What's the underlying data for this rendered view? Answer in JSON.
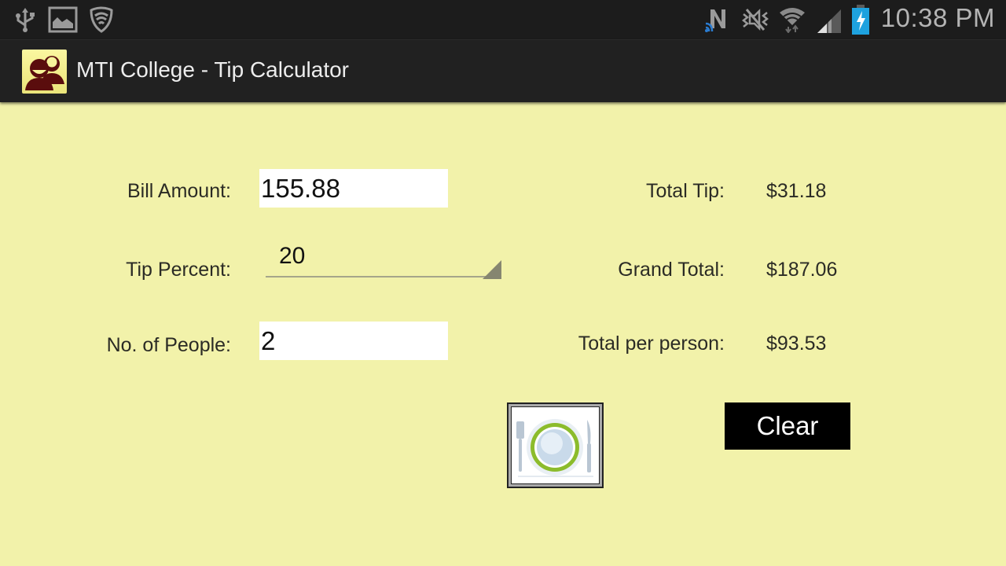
{
  "status_bar": {
    "left_icons": [
      "usb-icon",
      "image-icon",
      "shield-wifi-icon"
    ],
    "right_icons": [
      "nfc-icon",
      "mute-icon",
      "wifi-icon",
      "signal-icon",
      "battery-charging-icon"
    ],
    "time": "10:38 PM"
  },
  "action_bar": {
    "app_icon": "people-icon",
    "title": "MTI College - Tip Calculator"
  },
  "form": {
    "bill_amount": {
      "label": "Bill Amount:",
      "value": "155.88"
    },
    "tip_percent": {
      "label": "Tip Percent:",
      "selected": "20"
    },
    "people": {
      "label": "No. of People:",
      "value": "2"
    }
  },
  "results": {
    "total_tip": {
      "label": "Total Tip:",
      "value": "$31.18"
    },
    "grand_total": {
      "label": "Grand Total:",
      "value": "$187.06"
    },
    "per_person": {
      "label": "Total per person:",
      "value": "$93.53"
    }
  },
  "buttons": {
    "calculate_icon": "plate-cutlery-icon",
    "clear_label": "Clear"
  },
  "colors": {
    "background": "#f2f2aa",
    "status_bar": "#1c1c1c",
    "action_bar": "#212121",
    "battery": "#1ea2df",
    "plate_ring": "#8cbc2c"
  }
}
